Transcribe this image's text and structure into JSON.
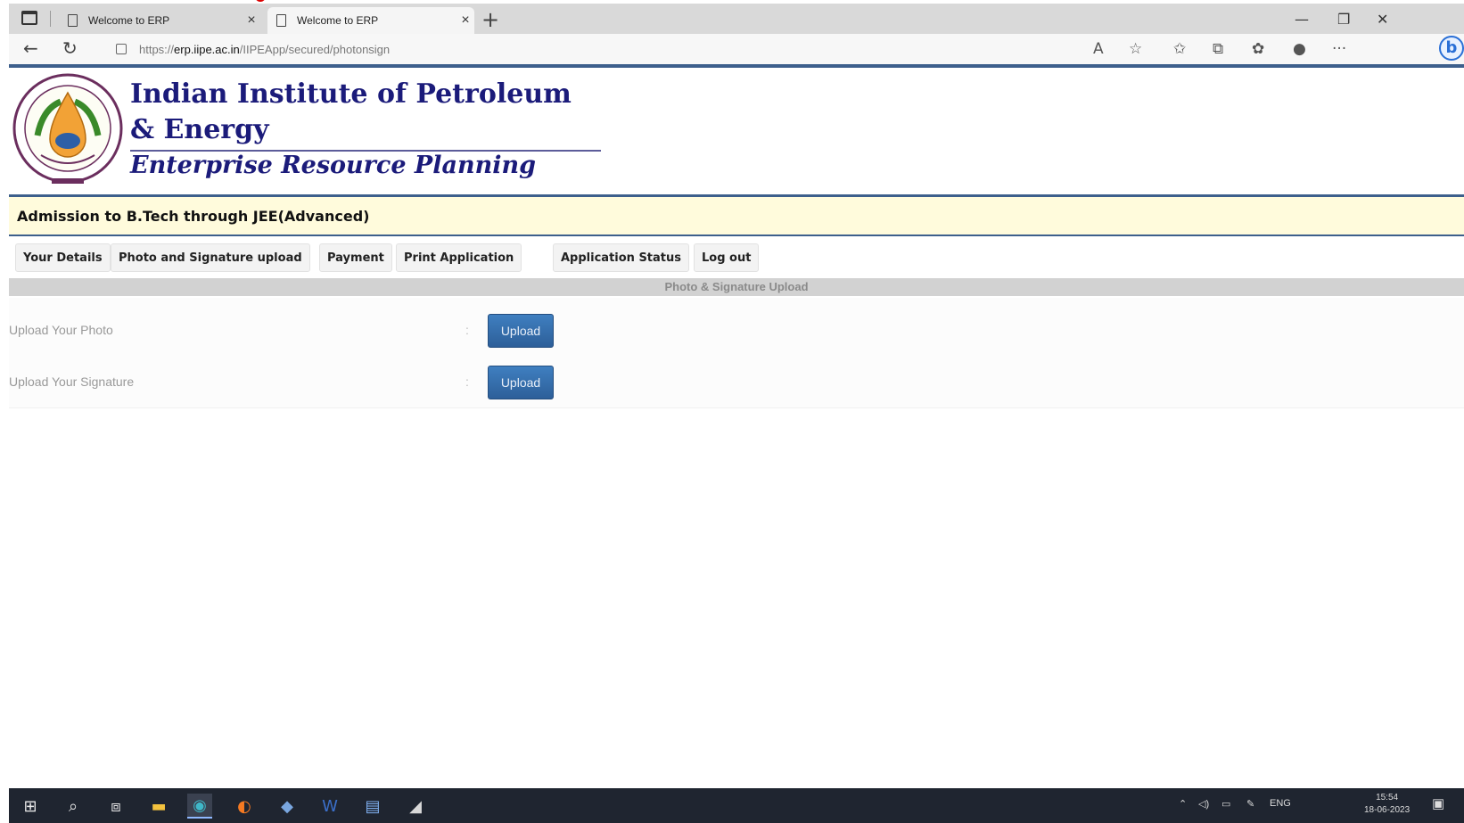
{
  "browser": {
    "tabs": [
      {
        "title": "Welcome to ERP"
      },
      {
        "title": "Welcome to ERP"
      }
    ],
    "url_prefix": "https://",
    "url_domain": "erp.iipe.ac.in",
    "url_path": "/IIPEApp/secured/photonsign"
  },
  "header": {
    "institute_name": "Indian Institute of Petroleum & Energy",
    "system_name": "Enterprise Resource Planning"
  },
  "banner": {
    "title": "Admission to B.Tech through JEE(Advanced)"
  },
  "menu": {
    "items": [
      {
        "label": "Your Details"
      },
      {
        "label": "Photo and Signature upload"
      },
      {
        "label": "Payment"
      },
      {
        "label": "Print Application"
      },
      {
        "label": "Application Status"
      },
      {
        "label": "Log out"
      }
    ]
  },
  "section": {
    "title": "Photo & Signature Upload"
  },
  "upload": {
    "photo_label": "Upload Your Photo",
    "signature_label": "Upload Your Signature",
    "separator": ":",
    "button_label": "Upload"
  },
  "taskbar": {
    "language": "ENG",
    "time": "15:54",
    "date": "18-06-2023"
  },
  "colors": {
    "brand_navy": "#1b1b7a",
    "rule_blue": "#3d5f8c",
    "banner_bg": "#fffbdc",
    "button_blue": "#3f7fc0"
  }
}
